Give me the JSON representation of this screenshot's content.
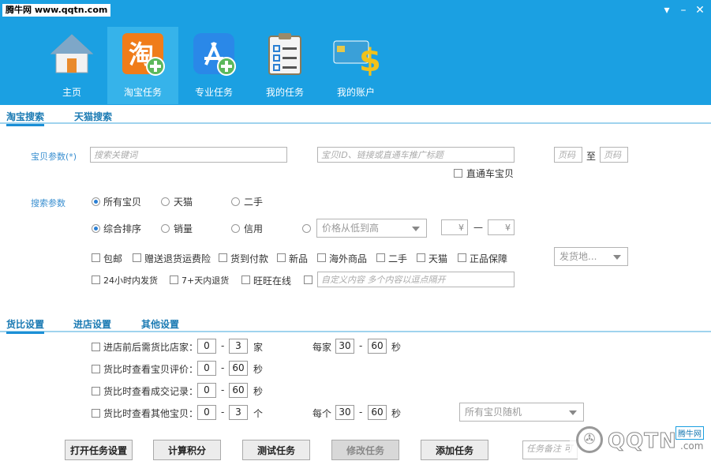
{
  "watermark_top": "腾牛网 www.qqtn.com",
  "window": {
    "minimize": "–",
    "close": "✕",
    "menu": "▾"
  },
  "nav": [
    {
      "label": "主页",
      "icon": "home-icon"
    },
    {
      "label": "淘宝任务",
      "icon": "taobao-add-icon"
    },
    {
      "label": "专业任务",
      "icon": "appstore-add-icon"
    },
    {
      "label": "我的任务",
      "icon": "clipboard-checklist-icon"
    },
    {
      "label": "我的账户",
      "icon": "card-dollar-icon"
    }
  ],
  "search_tabs": [
    "淘宝搜索",
    "天猫搜索"
  ],
  "search": {
    "label": "宝贝参数(*)",
    "keyword_placeholder": "搜索关键词",
    "id_placeholder": "宝贝ID、链接或直通车推广标题",
    "page_from_placeholder": "页码",
    "to_label": "至",
    "page_to_placeholder": "页码",
    "ztc_label": "直通车宝贝",
    "params_label": "搜索参数",
    "shop_types": [
      "所有宝贝",
      "天猫",
      "二手"
    ],
    "sorts": [
      "综合排序",
      "销量",
      "信用"
    ],
    "price_sort": "价格从低到高",
    "yen": "¥",
    "dash": "—",
    "filters_row1": [
      "包邮",
      "赠送退货运费险",
      "货到付款",
      "新品",
      "海外商品",
      "二手",
      "天猫",
      "正品保障"
    ],
    "location": "发货地...",
    "filters_row2": [
      "24小时内发货",
      "7+天内退货",
      "旺旺在线"
    ],
    "custom_placeholder": "自定义内容  多个内容以逗点隔开"
  },
  "settings_tabs": [
    "货比设置",
    "进店设置",
    "其他设置"
  ],
  "compare": {
    "rows": [
      {
        "label": "进店前后需货比店家：",
        "min": "0",
        "max": "3",
        "unit": "家"
      },
      {
        "label": "货比时查看宝贝评价：",
        "min": "0",
        "max": "60",
        "unit": "秒"
      },
      {
        "label": "货比时查看成交记录：",
        "min": "0",
        "max": "60",
        "unit": "秒"
      },
      {
        "label": "货比时查看其他宝贝：",
        "min": "0",
        "max": "3",
        "unit": "个"
      }
    ],
    "per_shop": {
      "label": "每家",
      "min": "30",
      "max": "60",
      "unit": "秒"
    },
    "per_item": {
      "label": "每个",
      "min": "30",
      "max": "60",
      "unit": "秒"
    },
    "random_select": "所有宝贝随机",
    "sep": "-"
  },
  "buttons": [
    "打开任务设置",
    "计算积分",
    "测试任务",
    "修改任务",
    "添加任务"
  ],
  "remark_placeholder": "任务备注 可",
  "watermark_bottom": {
    "brand": "QQTN",
    "suffix": ".com",
    "badge": "腾牛网"
  }
}
